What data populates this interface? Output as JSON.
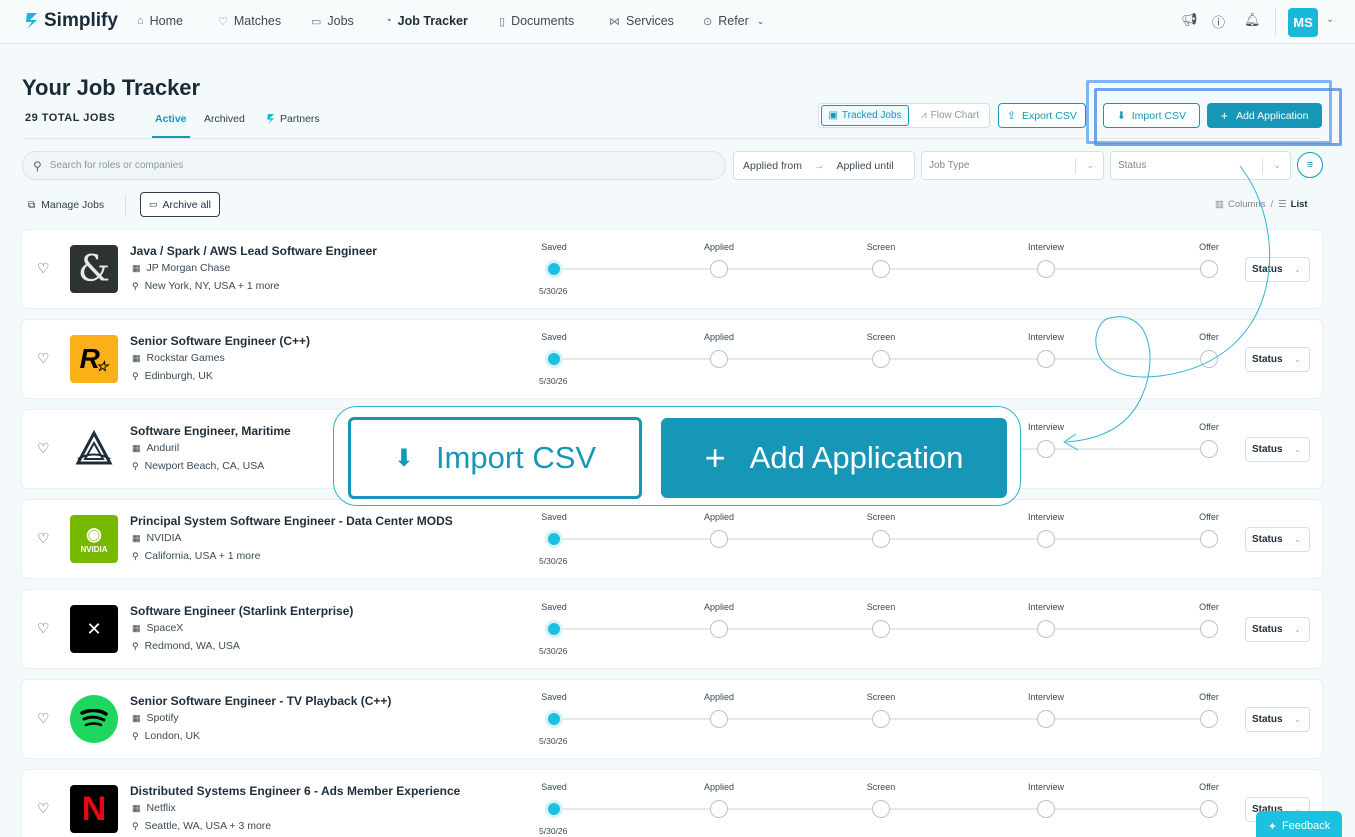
{
  "nav": {
    "brand": "Simplify",
    "items": [
      {
        "label": "Home",
        "icon": "home-icon"
      },
      {
        "label": "Matches",
        "icon": "heart-icon"
      },
      {
        "label": "Jobs",
        "icon": "briefcase-icon"
      },
      {
        "label": "Job Tracker",
        "icon": "tracker-icon"
      },
      {
        "label": "Documents",
        "icon": "document-icon"
      },
      {
        "label": "Services",
        "icon": "share-icon"
      },
      {
        "label": "Refer",
        "icon": "dollar-icon"
      }
    ],
    "avatar_initials": "MS"
  },
  "header": {
    "title": "Your Job Tracker",
    "total": "29 TOTAL JOBS",
    "tabs": [
      {
        "label": "Active"
      },
      {
        "label": "Archived"
      },
      {
        "label": "Partners"
      }
    ],
    "view_tabs": {
      "tracked": "Tracked Jobs",
      "flow": "Flow Chart"
    },
    "export_csv": "Export CSV",
    "import_csv": "Import CSV",
    "add_application": "Add Application"
  },
  "filters": {
    "search_placeholder": "Search for roles or companies",
    "applied_from": "Applied from",
    "applied_until": "Applied until",
    "job_type": "Job Type",
    "status": "Status"
  },
  "toolbar": {
    "manage_jobs": "Manage Jobs",
    "archive_all": "Archive all",
    "columns": "Columns",
    "slash": "/",
    "list": "List"
  },
  "stages": [
    "Saved",
    "Applied",
    "Screen",
    "Interview",
    "Offer"
  ],
  "jobs": [
    {
      "title": "Java / Spark / AWS Lead Software Engineer",
      "company": "JP Morgan Chase",
      "location": "New York, NY, USA + 1 more",
      "date": "5/30/26",
      "status_label": "Status",
      "logo": "jpmorgan-logo"
    },
    {
      "title": "Senior Software Engineer (C++)",
      "company": "Rockstar Games",
      "location": "Edinburgh, UK",
      "date": "5/30/26",
      "status_label": "Status",
      "logo": "rockstar-logo"
    },
    {
      "title": "Software Engineer, Maritime",
      "company": "Anduril",
      "location": "Newport Beach, CA, USA",
      "date": "",
      "status_label": "Status",
      "logo": "anduril-logo"
    },
    {
      "title": "Principal System Software Engineer - Data Center MODS",
      "company": "NVIDIA",
      "location": "California, USA + 1 more",
      "date": "5/30/26",
      "status_label": "Status",
      "logo": "nvidia-logo"
    },
    {
      "title": "Software Engineer (Starlink Enterprise)",
      "company": "SpaceX",
      "location": "Redmond, WA, USA",
      "date": "5/30/26",
      "status_label": "Status",
      "logo": "spacex-logo"
    },
    {
      "title": "Senior Software Engineer - TV Playback (C++)",
      "company": "Spotify",
      "location": "London, UK",
      "date": "5/30/26",
      "status_label": "Status",
      "logo": "spotify-logo"
    },
    {
      "title": "Distributed Systems Engineer 6 - Ads Member Experience",
      "company": "Netflix",
      "location": "Seattle, WA, USA + 3 more",
      "date": "5/30/26",
      "status_label": "Status",
      "logo": "netflix-logo"
    }
  ],
  "zoom": {
    "import_csv": "Import CSV",
    "add_application": "Add Application"
  },
  "feedback": "Feedback",
  "colors": {
    "accent": "#1697b8",
    "accent_light": "#1cc0e0",
    "highlight": "#4f8ee8"
  }
}
